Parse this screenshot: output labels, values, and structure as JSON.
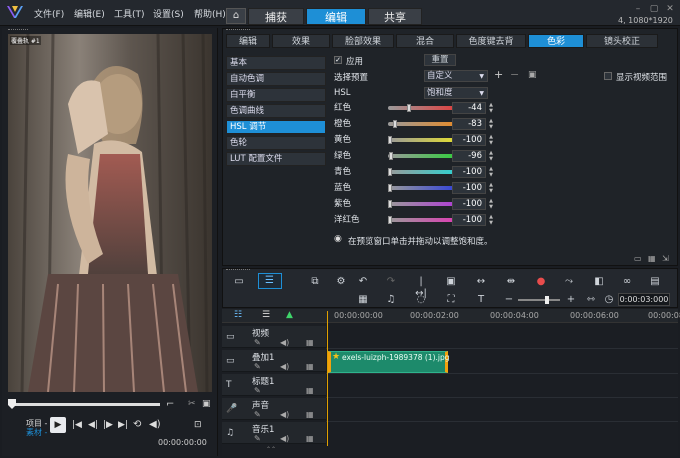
{
  "app": {
    "resolution": "4, 1080*1920"
  },
  "menu": [
    "文件(F)",
    "编辑(E)",
    "工具(T)",
    "设置(S)",
    "帮助(H)"
  ],
  "tabs": [
    "捕获",
    "编辑",
    "共享"
  ],
  "active_tab": "编辑",
  "preview": {
    "overlay_label": "覆叠轨 #1",
    "project_label": "项目 -",
    "clip_label": "素材 -",
    "timecode": "00:00:00:00"
  },
  "subtabs": [
    "编辑",
    "效果",
    "脸部效果",
    "混合",
    "色度键去背",
    "色彩",
    "镜头校正"
  ],
  "active_subtab": "色彩",
  "color_list": [
    "基本",
    "自动色调",
    "白平衡",
    "色调曲线",
    "HSL 调节",
    "色轮",
    "LUT 配置文件"
  ],
  "active_color": "HSL 调节",
  "hsl": {
    "apply_label": "应用",
    "reset_label": "重置",
    "preset_label": "选择预置",
    "preset_value": "自定义",
    "hsl_label": "HSL",
    "hsl_mode": "饱和度",
    "show_video_range": "显示视频范围",
    "hint": "在预览窗口单击并拖动以调整饱和度。",
    "sliders": [
      {
        "name": "红色",
        "value": "-44",
        "level": 0.28,
        "color": "#e23b3b"
      },
      {
        "name": "橙色",
        "value": "-83",
        "level": 0.08,
        "color": "#e98a25"
      },
      {
        "name": "黄色",
        "value": "-100",
        "level": 0.0,
        "color": "#e5e02c"
      },
      {
        "name": "绿色",
        "value": "-96",
        "level": 0.02,
        "color": "#2fcf3a"
      },
      {
        "name": "青色",
        "value": "-100",
        "level": 0.0,
        "color": "#2ad4d4"
      },
      {
        "name": "蓝色",
        "value": "-100",
        "level": 0.0,
        "color": "#2e3fdc"
      },
      {
        "name": "紫色",
        "value": "-100",
        "level": 0.0,
        "color": "#b03ad8"
      },
      {
        "name": "洋红色",
        "value": "-100",
        "level": 0.0,
        "color": "#e03ab5"
      }
    ]
  },
  "timeline": {
    "ticks": [
      "00:00:00:00",
      "00:00:02:00",
      "00:00:04:00",
      "00:00:06:00",
      "00:00:08"
    ],
    "timecode": "0:00:03:000",
    "tracks": [
      "视频",
      "叠加1",
      "标题1",
      "声音",
      "音乐1"
    ],
    "clip": "exels-luizph-1989378 (1).jpg"
  },
  "colors": {
    "accent": "#1e8fd6",
    "clip": "#1d8a6b",
    "clip_edge": "#f2a10d"
  }
}
